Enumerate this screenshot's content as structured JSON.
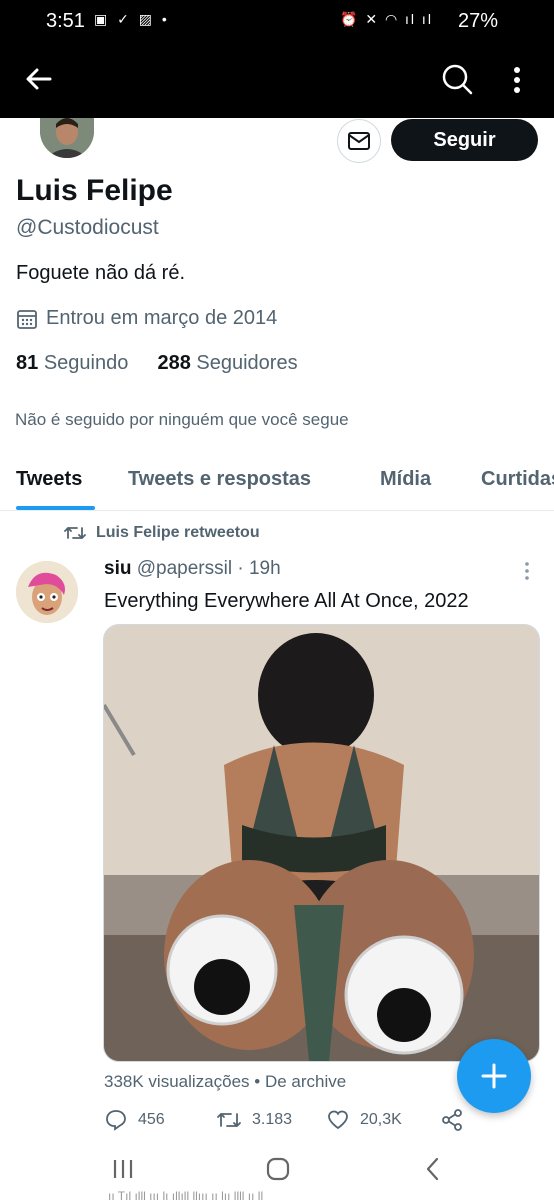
{
  "status_bar": {
    "time": "3:51",
    "left_icons": "▣ ✓ ▨ •",
    "right_icons": "⏰ ✕ ◠ ıl ıl",
    "battery": "27%"
  },
  "profile": {
    "name": "Luis Felipe",
    "handle": "@Custodiocust",
    "follow_label": "Seguir",
    "bio": "Foguete não dá ré.",
    "joined": "Entrou em março de 2014",
    "following_count": "81",
    "following_label": "Seguindo",
    "followers_count": "288",
    "followers_label": "Seguidores",
    "not_followed": "Não é seguido por ninguém que você segue"
  },
  "tabs": [
    {
      "label": "Tweets",
      "active": true
    },
    {
      "label": "Tweets e respostas",
      "active": false
    },
    {
      "label": "Mídia",
      "active": false
    },
    {
      "label": "Curtidas",
      "active": false
    }
  ],
  "tweet": {
    "retweet_note": "Luis Felipe retweetou",
    "author_name": "siu",
    "author_handle": "@paperssil",
    "separator": "·",
    "time": "19h",
    "text": "Everything Everywhere All At Once, 2022",
    "views": "338K visualizações",
    "views_sep": "•",
    "source": "De archive",
    "replies": "456",
    "retweets": "3.183",
    "likes": "20,3K"
  },
  "bottom_garble": "ıı Tıl ılll ııı lı ıllıll llııı ıı lıı llll ıı ll",
  "colors": {
    "accent": "#1d9bf0",
    "text": "#0f1419",
    "muted": "#536471",
    "border": "#cfd9de"
  }
}
